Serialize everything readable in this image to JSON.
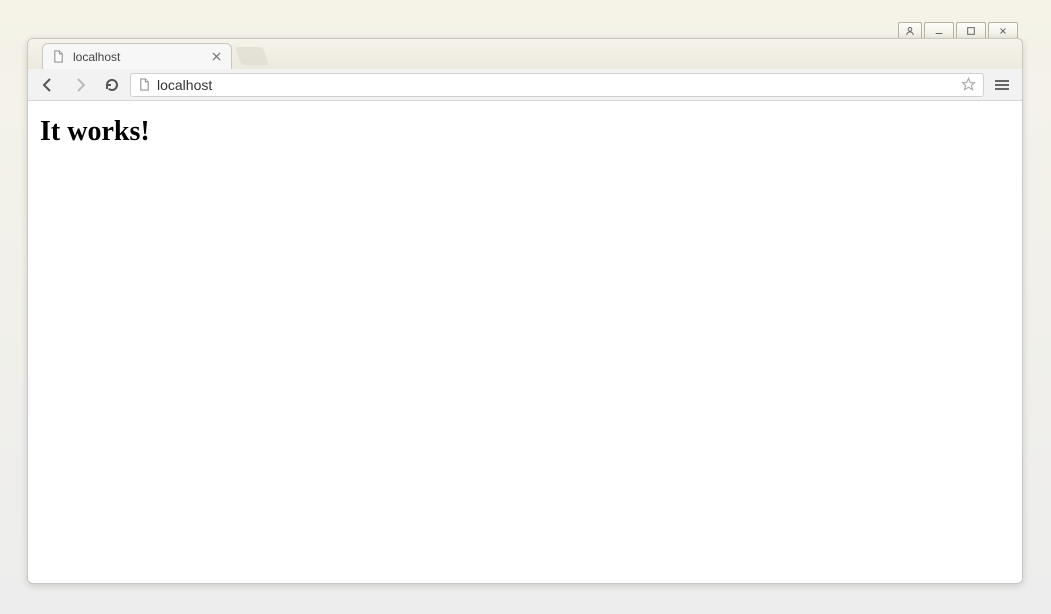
{
  "os_controls": {
    "user_icon": "user-icon",
    "minimize_icon": "minimize-icon",
    "maximize_icon": "maximize-icon",
    "close_icon": "close-icon"
  },
  "tab": {
    "favicon": "file-icon",
    "title": "localhost",
    "close_icon": "close-icon"
  },
  "toolbar": {
    "back_icon": "back-arrow-icon",
    "forward_icon": "forward-arrow-icon",
    "reload_icon": "reload-icon",
    "page_icon": "file-icon",
    "url": "localhost",
    "star_icon": "star-icon",
    "menu_icon": "hamburger-icon"
  },
  "page": {
    "heading": "It works!"
  }
}
